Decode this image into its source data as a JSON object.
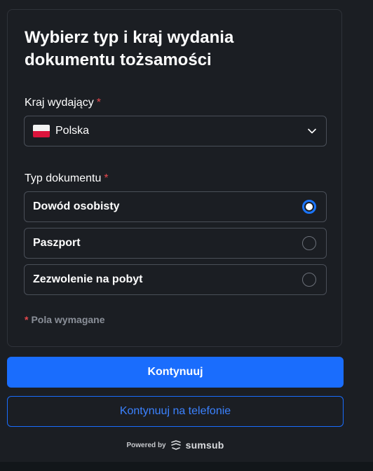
{
  "card": {
    "title": "Wybierz typ i kraj wydania dokumentu tożsamości"
  },
  "country": {
    "label": "Kraj wydający",
    "required_mark": "*",
    "value": "Polska",
    "flag_icon": "poland-flag-icon"
  },
  "document_type": {
    "label": "Typ dokumentu",
    "required_mark": "*",
    "options": [
      {
        "label": "Dowód osobisty",
        "selected": true
      },
      {
        "label": "Paszport",
        "selected": false
      },
      {
        "label": "Zezwolenie na pobyt",
        "selected": false
      }
    ]
  },
  "required_note": {
    "mark": "*",
    "text": "Pola wymagane"
  },
  "actions": {
    "continue_label": "Kontynuuj",
    "continue_phone_label": "Kontynuuj na telefonie"
  },
  "footer": {
    "powered_by": "Powered by",
    "brand": "sumsub"
  },
  "colors": {
    "accent": "#1a6dfd",
    "required": "#e5484d",
    "background": "#1b1e23"
  }
}
